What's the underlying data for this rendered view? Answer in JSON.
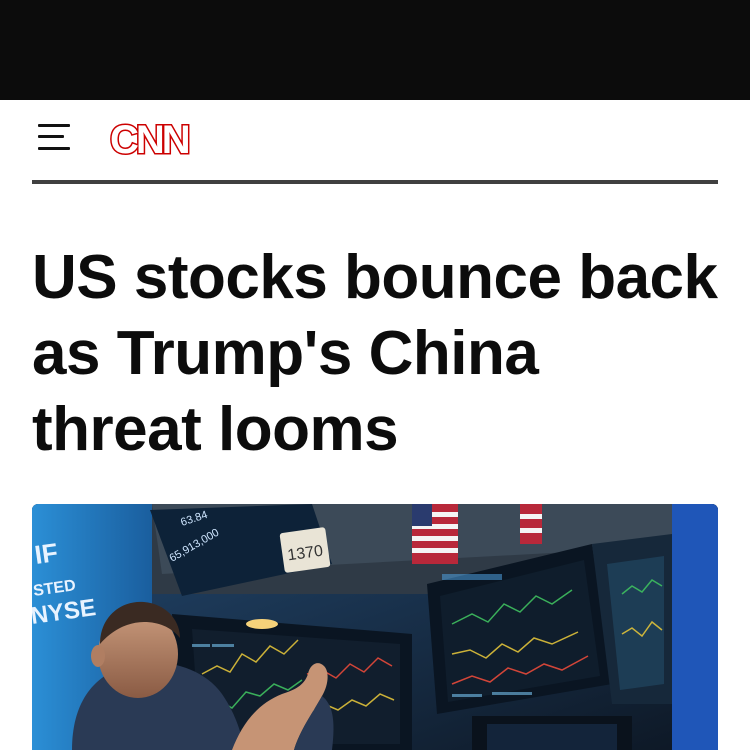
{
  "header": {
    "logo_text": "CNN",
    "logo_color": "#cc0000",
    "menu_icon": "hamburger-menu-icon"
  },
  "article": {
    "headline": "US stocks bounce back as Trump's China threat looms"
  },
  "hero_image": {
    "subject": "trader-at-stock-exchange-screens",
    "screen_labels": {
      "brand_lines": [
        "IF",
        "STED",
        "NYSE"
      ],
      "ticker_price": "63.84",
      "ticker_volume": "65,913,000",
      "post_number": "1370"
    }
  }
}
